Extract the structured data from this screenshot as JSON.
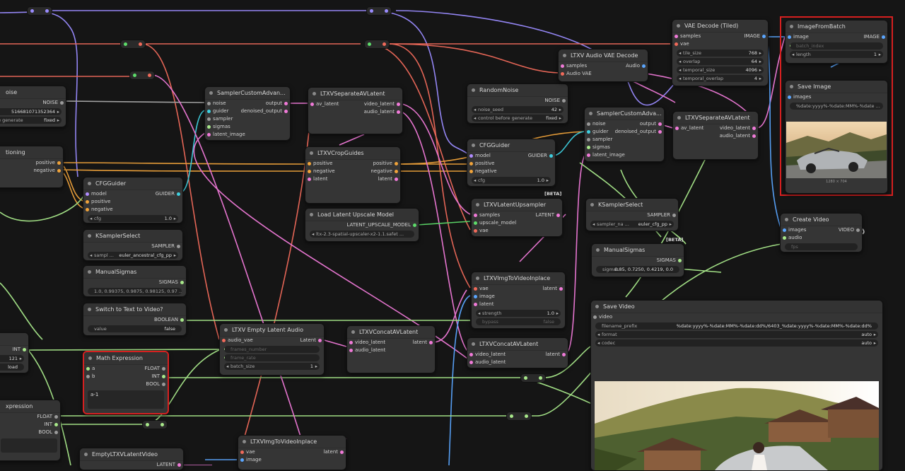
{
  "colors": {
    "background": "#151515",
    "node_bg": "#353535",
    "selection": "#d62020",
    "wire_latent": "#f07ad8",
    "wire_conditioning": "#f0a33a",
    "wire_vae": "#f06a5a",
    "wire_image": "#5aa6ff",
    "wire_int": "#a8e88a",
    "wire_model": "#b08cff"
  },
  "nodes": {
    "noise_left": {
      "title": "oise",
      "out": "NOISE",
      "seed": "516681071352364",
      "control_label": "ne generate",
      "control_value": "fixed"
    },
    "conditioning": {
      "title": "tioning",
      "out1": "positive",
      "out2": "negative"
    },
    "cfgguider_left": {
      "title": "CFGGuider",
      "in1": "model",
      "in2": "positive",
      "in3": "negative",
      "out": "GUIDER",
      "cfg_label": "cfg",
      "cfg_value": "1.0"
    },
    "ksampler_left": {
      "title": "KSamplerSelect",
      "out": "SAMPLER",
      "label": "sampl ...",
      "value": "euler_ancestral_cfg_pp"
    },
    "manualsigmas_left": {
      "title": "ManualSigmas",
      "out": "SIGMAS",
      "value": "1.0, 0.99375, 0.9875, 0.98125, 0.97 ..."
    },
    "switch": {
      "title": "Switch to Text to Video?",
      "out": "BOOLEAN",
      "label": "value",
      "value": "false"
    },
    "int_left": {
      "out": "INT",
      "value": "121",
      "control": "load"
    },
    "math": {
      "title": "Math Expression",
      "in1": "a",
      "in2": "b",
      "out1": "FLOAT",
      "out2": "INT",
      "out3": "BOOL",
      "expr": "a-1"
    },
    "expression_left": {
      "title": "xpression",
      "out1": "FLOAT",
      "out2": "INT",
      "out3": "BOOL"
    },
    "empty_latent_video": {
      "title": "EmptyLTXVLatentVideo",
      "out": "LATENT"
    },
    "sca1": {
      "title": "SamplerCustomAdvan...",
      "in1": "noise",
      "in2": "guider",
      "in3": "sampler",
      "in4": "sigmas",
      "in5": "latent_image",
      "out1": "output",
      "out2": "denoised_output"
    },
    "sep1": {
      "title": "LTXVSeparateAVLatent",
      "in1": "av_latent",
      "out1": "video_latent",
      "out2": "audio_latent"
    },
    "crop": {
      "title": "LTXVCropGuides",
      "in1": "positive",
      "in2": "negative",
      "in3": "latent",
      "out1": "positive",
      "out2": "negative",
      "out3": "latent"
    },
    "load_upscale": {
      "title": "Load Latent Upscale Model",
      "out": "LATENT_UPSCALE_MODEL",
      "value": "ltx-2.3-spatial-upscaler-x2-1.1.safet ..."
    },
    "empty_audio": {
      "title": "LTXV Empty Latent Audio",
      "in1": "audio_vae",
      "in2": "frames_number",
      "in3": "frame_rate",
      "out": "Latent",
      "batch_label": "batch_size",
      "batch_value": "1"
    },
    "concat1": {
      "title": "LTXVConcatAVLatent",
      "in1": "video_latent",
      "in2": "audio_latent",
      "out": "latent"
    },
    "img2vid_bottom": {
      "title": "LTXVImgToVideoInplace",
      "in1": "vae",
      "in2": "image",
      "out": "latent"
    },
    "randomnoise": {
      "title": "RandomNoise",
      "out": "NOISE",
      "seed_label": "noise_seed",
      "seed_value": "42",
      "control_label": "control before generate",
      "control_value": "fixed"
    },
    "cfgguider_mid": {
      "title": "CFGGuider",
      "in1": "model",
      "in2": "positive",
      "in3": "negative",
      "out": "GUIDER",
      "cfg_label": "cfg",
      "cfg_value": "1.0"
    },
    "upsampler": {
      "title": "LTXVLatentUpsampler",
      "badge": "[BETA]",
      "in1": "samples",
      "in2": "upscale_model",
      "in3": "vae",
      "out": "LATENT"
    },
    "img2vid_mid": {
      "title": "LTXVImgToVideoInplace",
      "in1": "vae",
      "in2": "image",
      "in3": "latent",
      "out": "latent",
      "strength_label": "strength",
      "strength_value": "1.0",
      "bypass_label": "bypass",
      "bypass_value": "false"
    },
    "concat2": {
      "title": "LTXVConcatAVLatent",
      "in1": "video_latent",
      "in2": "audio_latent",
      "out": "latent"
    },
    "audio_vae_decode": {
      "title": "LTXV Audio VAE Decode",
      "in1": "samples",
      "in2": "Audio VAE",
      "out": "Audio"
    },
    "sca2": {
      "title": "SamplerCustomAdva...",
      "in1": "noise",
      "in2": "guider",
      "in3": "sampler",
      "in4": "sigmas",
      "in5": "latent_image",
      "out1": "output",
      "out2": "denoised_output"
    },
    "sep2": {
      "title": "LTXVSeparateAVLatent",
      "in1": "av_latent",
      "out1": "video_latent",
      "out2": "audio_latent"
    },
    "ksampler_mid": {
      "title": "KSamplerSelect",
      "out": "SAMPLER",
      "label": "sampler_na ...",
      "value": "euler_cfg_pp",
      "badge": "[BETA]"
    },
    "manualsigmas_mid": {
      "title": "ManualSigmas",
      "out": "SIGMAS",
      "label": "sigmas",
      "value": "0.85, 0.7250, 0.4219, 0.0"
    },
    "vae_decode_tiled": {
      "title": "VAE Decode (Tiled)",
      "in1": "samples",
      "in2": "vae",
      "out": "IMAGE",
      "w1_label": "tile_size",
      "w1_value": "768",
      "w2_label": "overlap",
      "w2_value": "64",
      "w3_label": "temporal_size",
      "w3_value": "4096",
      "w4_label": "temporal_overlap",
      "w4_value": "4"
    },
    "image_from_batch": {
      "title": "ImageFromBatch",
      "in1": "image",
      "in2": "batch_index",
      "out": "IMAGE",
      "length_label": "length",
      "length_value": "1"
    },
    "save_image": {
      "title": "Save Image",
      "in1": "images",
      "filename": "%date:yyyy%-%date:MM%-%date ...",
      "caption": "1280 × 704"
    },
    "create_video": {
      "title": "Create Video",
      "in1": "images",
      "in2": "audio",
      "in3": "fps",
      "out": "VIDEO"
    },
    "save_video": {
      "title": "Save Video",
      "in1": "video",
      "prefix_label": "filename_prefix",
      "prefix_value": "%date:yyyy%-%date:MM%-%date:dd%/6403_%date:yyyy%-%date:MM%-%date:dd%",
      "format_label": "format",
      "format_value": "auto",
      "codec_label": "codec",
      "codec_value": "auto"
    }
  }
}
